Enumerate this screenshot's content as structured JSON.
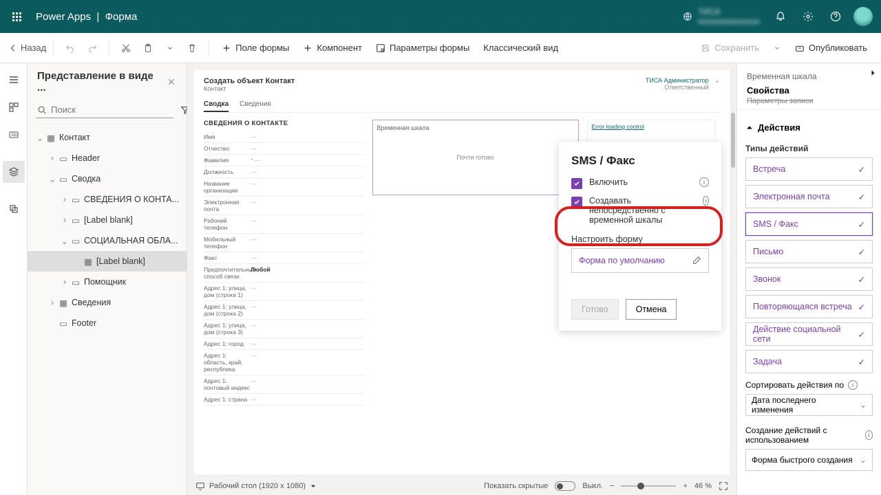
{
  "header": {
    "appName": "Power Apps",
    "pageName": "Форма",
    "envLabel": "ТИСА"
  },
  "cmd": {
    "back": "Назад",
    "formField": "Поле формы",
    "component": "Компонент",
    "formParams": "Параметры формы",
    "classic": "Классический вид",
    "save": "Сохранить",
    "publish": "Опубликовать"
  },
  "tree": {
    "title": "Представление в виде ...",
    "searchPlaceholder": "Поиск",
    "contact": "Контакт",
    "header": "Header",
    "summary": "Сводка",
    "contactInfo": "СВЕДЕНИЯ О КОНТА...",
    "labelBlank": "[Label blank]",
    "socialArea": "СОЦИАЛЬНАЯ ОБЛА...",
    "helper": "Помощник",
    "details": "Сведения",
    "footer": "Footer"
  },
  "form": {
    "title": "Создать объект Контакт",
    "entity": "Контакт",
    "tabSummary": "Сводка",
    "tabDetails": "Сведения",
    "ownerName": "ТИСА Администратор",
    "ownerSub": "Ответственный",
    "section1": "СВЕДЕНИЯ О КОНТАКТЕ",
    "timelineLabel": "Временная шкала",
    "timelineCenter": "Почти готово",
    "errorText": "Error loading control",
    "fields": {
      "name": "Имя",
      "middle": "Отчество",
      "surname": "Фамилия",
      "job": "Должность",
      "org": "Название организации",
      "email": "Электронная почта",
      "workPhone": "Рабочий телефон",
      "mobile": "Мобильный телефон",
      "fax": "Факс",
      "preferred": "Предпочтительный способ связи",
      "preferredVal": "Любой",
      "addr1": "Адрес 1: улица, дом (строка 1)",
      "addr2": "Адрес 1: улица, дом (строка 2)",
      "addr3": "Адрес 1: улица, дом (строка 3)",
      "city": "Адрес 1: город",
      "region": "Адрес 1: область, край, республика",
      "zip": "Адрес 1: почтовый индекс",
      "country": "Адрес 1: страна"
    }
  },
  "popup": {
    "title": "SMS / Факс",
    "enable": "Включить",
    "createDirect": "Создавать непосредственно с временной шкалы",
    "configForm": "Настроить форму",
    "defaultForm": "Форма по умолчанию",
    "done": "Готово",
    "cancel": "Отмена"
  },
  "props": {
    "crumb": "Временная шкала",
    "title": "Свойства",
    "struck": "Параметры записи",
    "actionsHeader": "Действия",
    "actionTypes": "Типы действий",
    "actions": {
      "meeting": "Встреча",
      "email": "Электронная почта",
      "sms": "SMS / Факс",
      "letter": "Письмо",
      "call": "Звонок",
      "recurring": "Повторяющаяся встреча",
      "social": "Действие социальной сети",
      "task": "Задача"
    },
    "sortBy": "Сортировать действия по",
    "sortVal": "Дата последнего изменения",
    "createWith": "Создание действий с использованием",
    "quickForm": "Форма быстрого создания"
  },
  "bottom": {
    "viewport": "Рабочий стол (1920 x 1080)",
    "showHidden": "Показать скрытые",
    "off": "Выкл.",
    "zoom": "46 %"
  }
}
